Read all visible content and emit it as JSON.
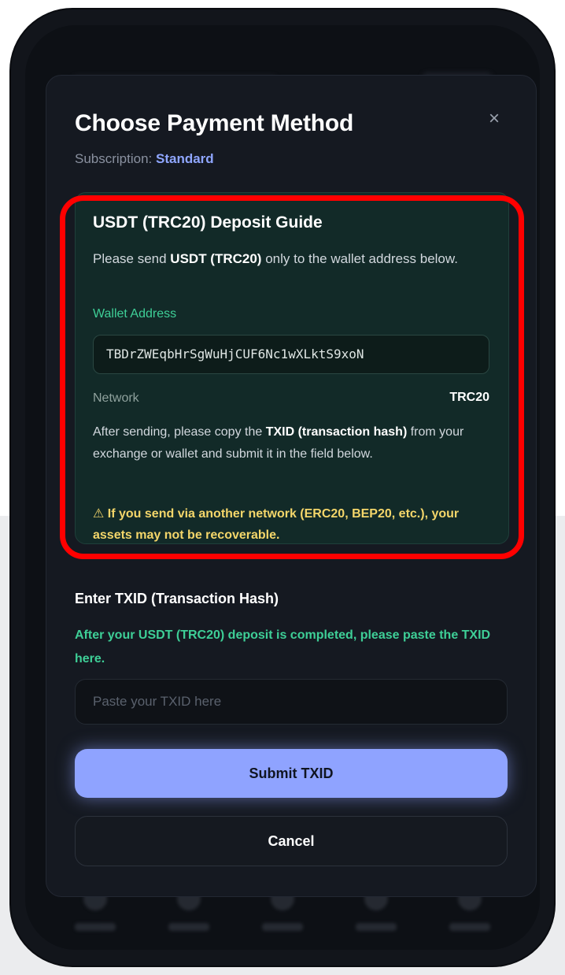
{
  "modal": {
    "title": "Choose Payment Method",
    "close_icon": "×",
    "subtitle_prefix": "Subscription: ",
    "subtitle_plan": "Standard"
  },
  "guide": {
    "title": "USDT (TRC20) Deposit Guide",
    "desc_prefix": "Please send ",
    "desc_bold": "USDT (TRC20)",
    "desc_suffix": " only to the wallet address below.",
    "wallet_label": "Wallet Address",
    "wallet_address": "TBDrZWEqbHrSgWuHjCUF6Nc1wXLktS9xoN",
    "network_label": "Network",
    "network_value": "TRC20",
    "after_prefix": "After sending, please copy the ",
    "after_bold": "TXID (transaction hash)",
    "after_suffix": " from your exchange or wallet and submit it in the field below.",
    "warning": "⚠ If you send via another network (ERC20, BEP20, etc.), your assets may not be recoverable."
  },
  "txid": {
    "label": "Enter TXID (Transaction Hash)",
    "help": "After your USDT (TRC20) deposit is completed, please paste the TXID here.",
    "placeholder": "Paste your TXID here",
    "value": ""
  },
  "buttons": {
    "submit": "Submit TXID",
    "cancel": "Cancel"
  },
  "colors": {
    "accent": "#8fa3ff",
    "success": "#3ecf97",
    "warning": "#f4d66a",
    "highlight": "#ff0000"
  }
}
